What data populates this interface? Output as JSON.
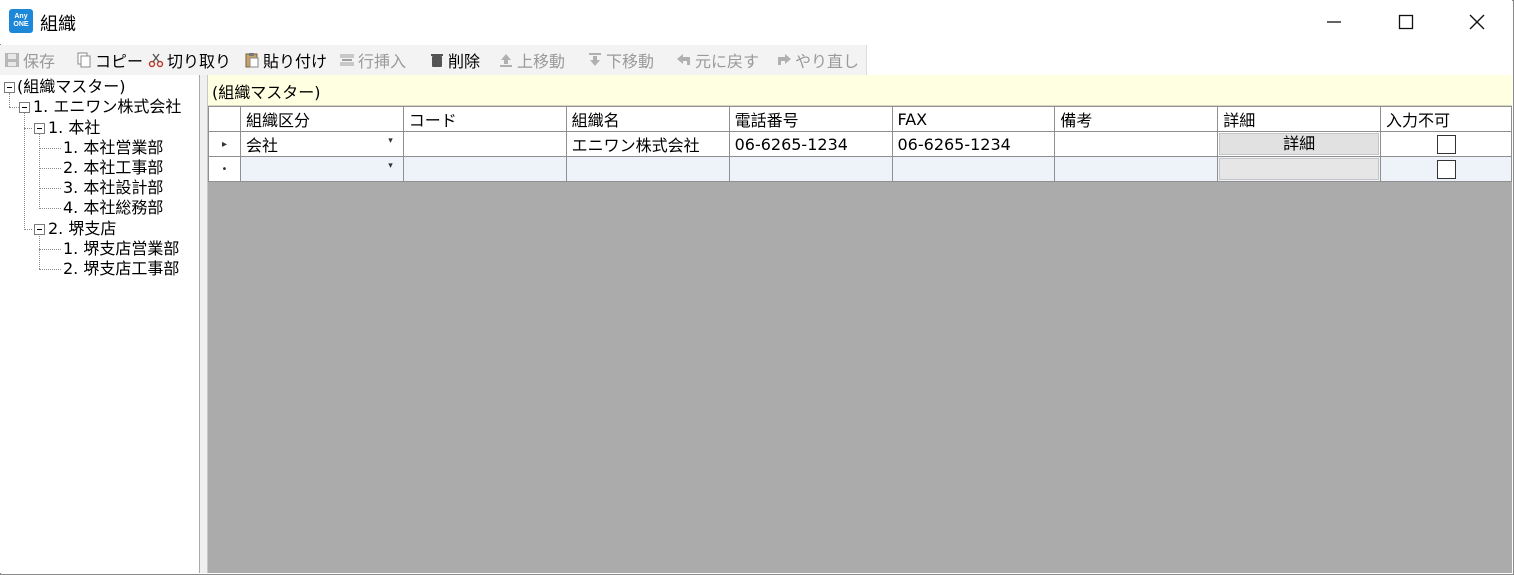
{
  "window": {
    "title": "組織",
    "app_icon_text": [
      "Any",
      "ONE"
    ],
    "minimize_label": "minimize",
    "maximize_label": "maximize",
    "close_label": "close"
  },
  "toolbar": {
    "items": [
      {
        "label": "保存",
        "icon": "save-icon",
        "enabled": false
      },
      {
        "label": "コピー",
        "icon": "copy-icon",
        "enabled": true
      },
      {
        "label": "切り取り",
        "icon": "scissors-icon",
        "enabled": true
      },
      {
        "label": "貼り付け",
        "icon": "paste-icon",
        "enabled": true
      },
      {
        "label": "行挿入",
        "icon": "insert-row-icon",
        "enabled": false
      },
      {
        "label": "削除",
        "icon": "trash-icon",
        "enabled": true
      },
      {
        "label": "上移動",
        "icon": "move-up-icon",
        "enabled": false
      },
      {
        "label": "下移動",
        "icon": "move-down-icon",
        "enabled": false
      },
      {
        "label": "元に戻す",
        "icon": "undo-icon",
        "enabled": false
      },
      {
        "label": "やり直し",
        "icon": "redo-icon",
        "enabled": false
      }
    ]
  },
  "tree": {
    "root": "(組織マスター)",
    "company": "1. エニワン株式会社",
    "branch1": "1. 本社",
    "branch1_children": [
      "1. 本社営業部",
      "2. 本社工事部",
      "3. 本社設計部",
      "4. 本社総務部"
    ],
    "branch2": "2. 堺支店",
    "branch2_children": [
      "1. 堺支店営業部",
      "2. 堺支店工事部"
    ]
  },
  "header_band": {
    "text": "(組織マスター)"
  },
  "grid": {
    "columns": [
      "組織区分",
      "コード",
      "組織名",
      "電話番号",
      "FAX",
      "備考",
      "詳細",
      "入力不可"
    ],
    "rows": [
      {
        "category": "会社",
        "code": "",
        "name": "エニワン株式会社",
        "phone": "06-6265-1234",
        "fax": "06-6265-1234",
        "note": "",
        "detail_label": "詳細",
        "locked": false
      },
      {
        "category": "",
        "code": "",
        "name": "",
        "phone": "",
        "fax": "",
        "note": "",
        "detail_label": "",
        "locked": false
      }
    ],
    "combo_arrow": "▾"
  },
  "colors": {
    "accent": "#1e88d8",
    "band": "#ffffe1",
    "grid_bg": "#ababab"
  }
}
